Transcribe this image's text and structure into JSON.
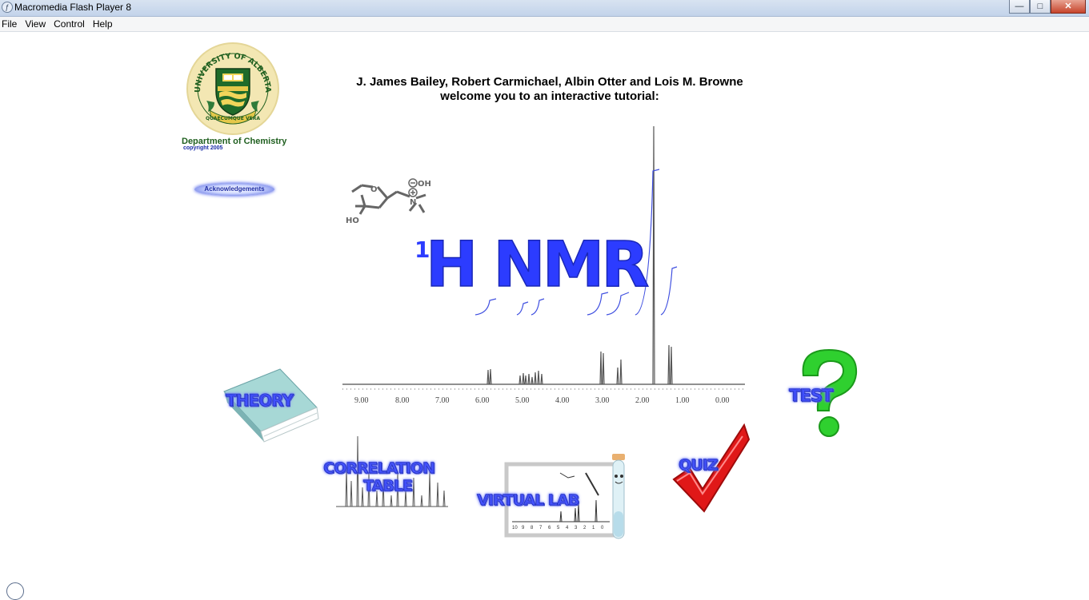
{
  "window": {
    "title": "Macromedia Flash Player 8",
    "controls": {
      "minimize": "—",
      "maximize": "□",
      "close": "✕"
    }
  },
  "menu": [
    {
      "label": "File"
    },
    {
      "label": "View"
    },
    {
      "label": "Control"
    },
    {
      "label": "Help"
    }
  ],
  "header": {
    "department": "Department of Chemistry",
    "copyright": "copyright 2005",
    "acknowledgements_label": "Acknowledgements",
    "authors_line1": "J. James Bailey, Robert Carmichael, Albin Otter and Lois M. Browne",
    "authors_line2": "welcome you to an interactive tutorial:"
  },
  "logo": {
    "top_text": "UNIVERSITY OF ALBERTA",
    "motto": "QUAECUMQUE VERA"
  },
  "hero": {
    "superscript": "1",
    "title": "H NMR",
    "molecule": {
      "hydroxyl": "HO",
      "ring_oxygen": "O",
      "anion": "OH",
      "nitrogen": "N"
    },
    "spectrum_ticks": [
      "9.00",
      "8.00",
      "7.00",
      "6.00",
      "5.00",
      "4.00",
      "3.00",
      "2.00",
      "1.00",
      "0.00"
    ]
  },
  "nav": {
    "theory": "THEORY",
    "correlation_line1": "CORRELATION",
    "correlation_line2": "TABLE",
    "virtual_lab": "VIRTUAL LAB",
    "quiz": "QUIZ",
    "test": "TEST"
  },
  "virtual_lab_board": {
    "ticks": [
      "10",
      "9",
      "8",
      "7",
      "6",
      "5",
      "4",
      "3",
      "2",
      "1",
      "0"
    ]
  },
  "colors": {
    "accent_blue": "#2c3cff",
    "spectrum_gray": "#555555",
    "integral_blue": "#4050e0",
    "ualberta_green": "#1f5f1f",
    "ualberta_gold": "#e5c84a",
    "check_red": "#e01818",
    "question_green": "#2fd02f"
  }
}
